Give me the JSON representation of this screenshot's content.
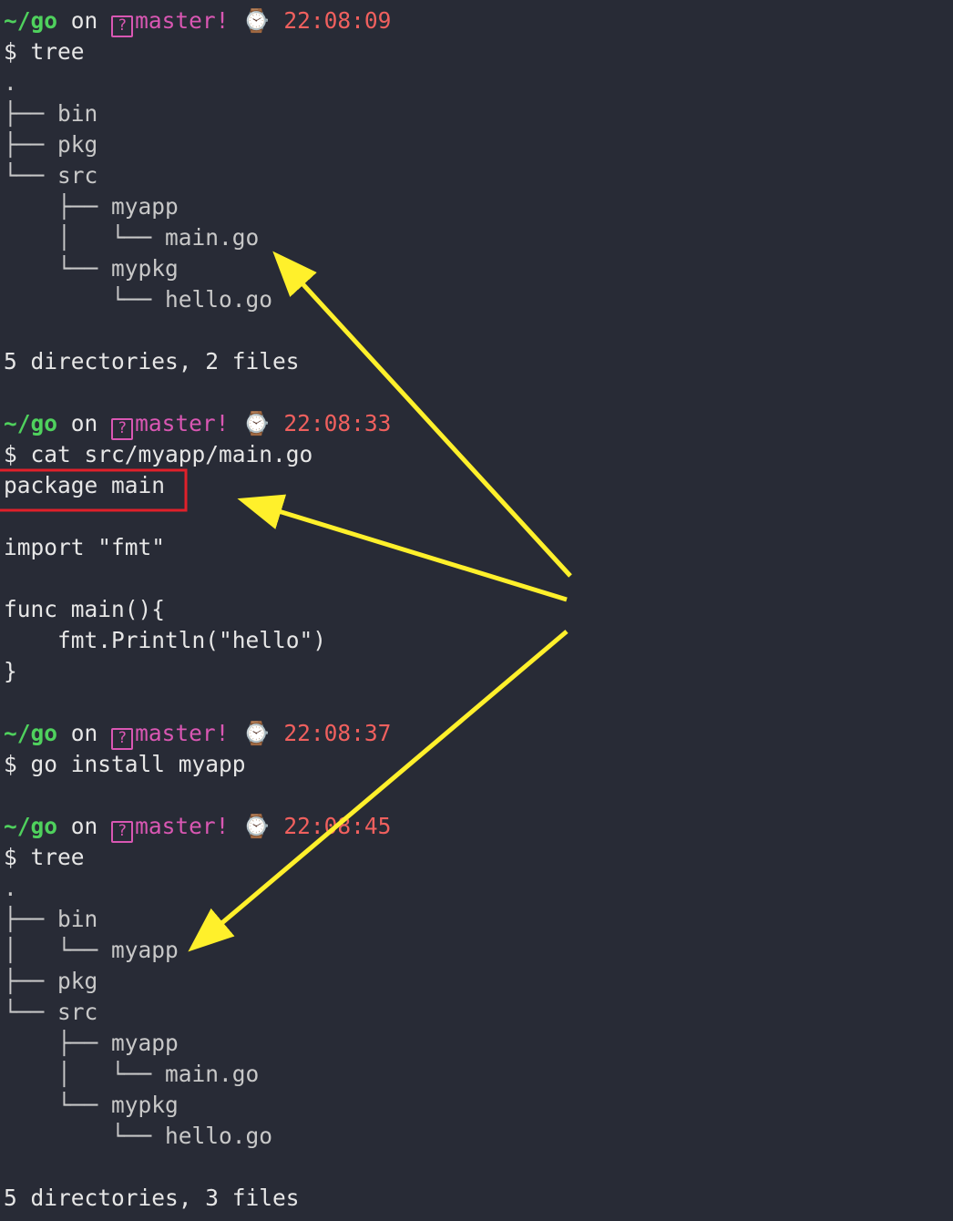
{
  "colors": {
    "background": "#282b36",
    "text": "#e6e6e6",
    "cwd": "#4fd15d",
    "branch": "#d957b3",
    "time": "#f0605e",
    "highlight_box": "#e0202a",
    "arrow": "#fff02b"
  },
  "prompts": [
    {
      "cwd": "~/go",
      "on": "on",
      "branch_icon": "?",
      "branch": "master!",
      "clock_icon": "watch-icon",
      "time": "22:08:09",
      "command": "$ tree"
    },
    {
      "cwd": "~/go",
      "on": "on",
      "branch_icon": "?",
      "branch": "master!",
      "clock_icon": "watch-icon",
      "time": "22:08:33",
      "command": "$ cat src/myapp/main.go"
    },
    {
      "cwd": "~/go",
      "on": "on",
      "branch_icon": "?",
      "branch": "master!",
      "clock_icon": "watch-icon",
      "time": "22:08:37",
      "command": "$ go install myapp"
    },
    {
      "cwd": "~/go",
      "on": "on",
      "branch_icon": "?",
      "branch": "master!",
      "clock_icon": "watch-icon",
      "time": "22:08:45",
      "command": "$ tree"
    }
  ],
  "tree1": [
    ".",
    "├── bin",
    "├── pkg",
    "└── src",
    "    ├── myapp",
    "    │   └── main.go",
    "    └── mypkg",
    "        └── hello.go"
  ],
  "tree1_summary": "5 directories, 2 files",
  "code": {
    "package_line": "package main",
    "import_line": "import \"fmt\"",
    "func_line": "func main(){",
    "body_line": "    fmt.Println(\"hello\")",
    "close_line": "}"
  },
  "tree2": [
    ".",
    "├── bin",
    "│   └── myapp",
    "├── pkg",
    "└── src",
    "    ├── myapp",
    "    │   └── main.go",
    "    └── mypkg",
    "        └── hello.go"
  ],
  "tree2_summary": "5 directories, 3 files"
}
